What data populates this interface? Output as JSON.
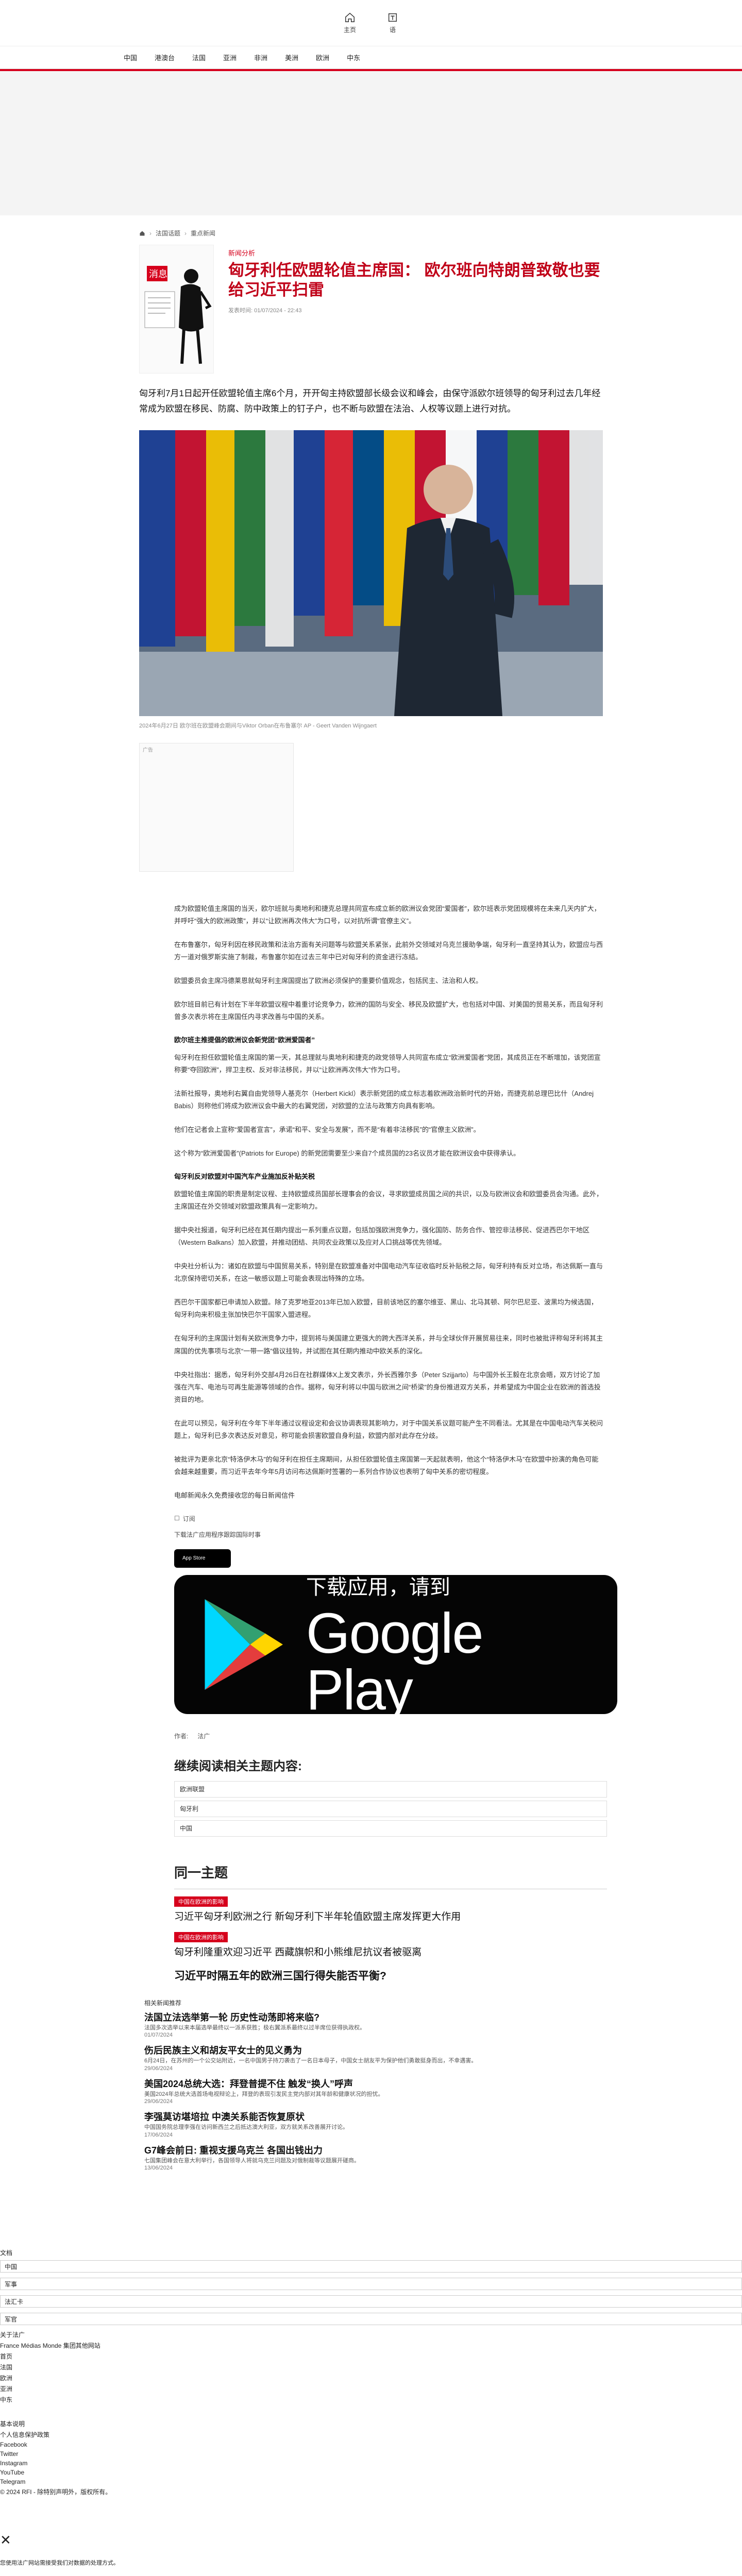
{
  "topbar": {
    "home_label": "主页",
    "lang_label": "语"
  },
  "nav": [
    "中国",
    "港澳台",
    "法国",
    "亚洲",
    "非洲",
    "美洲",
    "欧洲",
    "中东"
  ],
  "breadcrumb": [
    "首页",
    "法国话题",
    "重点新闻"
  ],
  "article": {
    "kicker": "新闻分析",
    "title": "匈牙利任欧盟轮值主席国： 欧尔班向特朗普致敬也要给习近平扫雷",
    "meta": "发表时间: 01/07/2024 - 22:43",
    "lead": "匈牙利7月1日起开任欧盟轮值主席6个月，开开匈主持欧盟部长级会议和峰会，由保守派欧尔班领导的匈牙利过去几年经常成为欧盟在移民、防腐、防中政策上的钉子户，也不断与欧盟在法治、人权等议题上进行对抗。",
    "caption": "2024年6月27日 欧尔班在欧盟峰会期间与Viktor Orban在布鲁塞尔 AP - Geert Vanden Wijngaert",
    "ad_label": "广告",
    "paragraphs": [
      "成为欧盟轮值主席国的当天，欧尔班就与奥地利和捷克总理共同宣布成立新的欧洲议会党团“爱国者”，欧尔班表示党团规模将在未来几天内扩大，并呼吁“强大的欧洲政策”，并以“让欧洲再次伟大”为口号，以对抗所谓“官僚主义”。",
      "在布鲁塞尔，匈牙利因在移民政策和法治方面有关问题等与欧盟关系紧张，此前外交领域对乌克兰援助争端，匈牙利一直坚持其认为，欧盟应与西方一道对俄罗斯实施了制裁，布鲁塞尔如在过去三年中已对匈牙利的资金进行冻结。",
      "欧盟委员会主席冯德莱恩就匈牙利主席国提出了欧洲必须保护的重要价值观念，包括民主、法治和人权。",
      "欧尔班目前已有计划在下半年欧盟议程中着重讨论竞争力，欧洲的国防与安全、移民及欧盟扩大，也包括对中国、对美国的贸易关系，而且匈牙利曾多次表示将在主席国任内寻求改善与中国的关系。"
    ],
    "h1": "欧尔班主推提倡的欧洲议会新党团“欧洲爱国者”",
    "p2": [
      "匈牙利在担任欧盟轮值主席国的第一天，其总理就与奥地利和捷克的政党领导人共同宣布成立“欧洲爱国者”党团，其成员正在不断增加，该党团宣称要“夺回欧洲”，捍卫主权、反对非法移民，并以“让欧洲再次伟大”作为口号。",
      "法新社报导，奥地利右翼自由党领导人基克尔（Herbert Kickl）表示新党团的成立标志着欧洲政治新时代的开始，而捷克前总理巴比什（Andrej Babis）则称他们将成为欧洲议会中最大的右翼党团，对欧盟的立法与政策方向具有影响。",
      "他们在记者会上宣称“爱国者宣言”，承诺“和平、安全与发展”，而不是“有着非法移民”的“官僚主义欧洲”。",
      "这个称为“欧洲爱国者”(Patriots for Europe) 的新党团需要至少来自7个成员国的23名议员才能在欧洲议会中获得承认。"
    ],
    "h2": "匈牙利反对欧盟对中国汽车产业施加反补贴关税",
    "p3": [
      "欧盟轮值主席国的职责是制定议程、主持欧盟成员国部长理事会的会议，寻求欧盟成员国之间的共识，以及与欧洲议会和欧盟委员会沟通。此外，主席国还在外交领域对欧盟政策具有一定影响力。",
      "据中央社报道，匈牙利已经在其任期内提出一系列重点议题，包括加强欧洲竞争力，强化国防、防务合作、管控非法移民、促进西巴尔干地区（Western Balkans）加入欧盟，并推动团结、共同农业政策以及应对人口挑战等优先领域。",
      "中央社分析认为：诸如在欧盟与中国贸易关系，特别是在欧盟准备对中国电动汽车征收临时反补贴税之际，匈牙利持有反对立场，布达佩斯一直与北京保持密切关系，在这一敏感议题上可能会表现出特殊的立场。",
      "西巴尔干国家都已申请加入欧盟。除了克罗地亚2013年已加入欧盟，目前该地区的塞尔维亚、黑山、北马其顿、阿尔巴尼亚、波黑均为候选国，匈牙利向来积极主张加快巴尔干国家入盟进程。",
      "在匈牙利的主席国计划有关欧洲竞争力中，提到将与美国建立更强大的跨大西洋关系，并与全球伙伴开展贸易往来，同时也被批评称匈牙利将其主席国的优先事项与北京“一带一路”倡议挂钩，并试图在其任期内推动中欧关系的深化。",
      "中央社指出：据悉，匈牙利外交部4月26日在社群媒体X上发文表示，外长西雅尔多（Peter Szijjarto）与中国外长王毅在北京会晤，双方讨论了加强在汽车、电池与可再生能源等领域的合作。据称，匈牙利将以中国与欧洲之间“桥梁”的身份推进双方关系，并希望成为中国企业在欧洲的首选投资目的地。",
      "在此可以预见，匈牙利在今年下半年通过议程设定和会议协调表现其影响力，对于中国关系议题可能产生不同看法。尤其是在中国电动汽车关税问题上，匈牙利已多次表达反对意见，称可能会损害欧盟自身利益，欧盟内部对此存在分歧。",
      "被批评为更亲北京“特洛伊木马”的匈牙利在担任主席期间，从担任欧盟轮值主席国第一天起就表明，他这个“特洛伊木马”在欧盟中扮演的角色可能会越来越重要，而习近平去年今年5月访问布达佩斯时签署的一系列合作协议也表明了匈中关系的密切程度。"
    ],
    "more": "电邮新闻永久免费接收您的每日新闻信件"
  },
  "subscribe": {
    "label": "订阅",
    "text": "下载法广应用程序跟踪国际时事",
    "appstore": "App Store",
    "gplay_small": "下载应用，请到",
    "gplay_big": "Google Play"
  },
  "author": {
    "label": "作者:",
    "name": "法广"
  },
  "related": {
    "title": "继续阅读相关主题内容:",
    "tags": [
      "欧洲联盟",
      "匈牙利",
      "中国"
    ]
  },
  "sametopic": {
    "title": "同一主题",
    "items": [
      {
        "badge": "中国在欧洲的影响",
        "title": "习近平匈牙利欧洲之行 新匈牙利下半年轮值欧盟主席发挥更大作用"
      },
      {
        "badge": "中国在欧洲的影响",
        "title": "匈牙利隆重欢迎习近平 西藏旗帜和小熊维尼抗议者被驱离"
      },
      {
        "badge": "",
        "title": "习近平时隔五年的欧洲三国行得失能否平衡?"
      }
    ]
  },
  "more_list": {
    "head": "相关新闻推荐",
    "items": [
      {
        "title": "法国立法选举第一轮 历史性动荡即将来临?",
        "sub": "法国多次选举以来本届选举最终以一派系获胜；极右翼派系最终以过半席位获得执政权。",
        "date": "01/07/2024"
      },
      {
        "title": "伤后民族主义和胡友平女士的见义勇为",
        "sub": "6月24日，在苏州的一个公交站附近，一名中国男子持刀袭击了一名日本母子，中国女士胡友平为保护他们勇敢挺身而出，不幸遇害。",
        "date": "29/06/2024"
      },
      {
        "title": "美国2024总统大选：拜登普提不住 触发“换人”呼声",
        "sub": "美国2024年总统大选首场电视辩论上，拜登的表现引发民主党内部对其年龄和健康状况的担忧。",
        "date": "29/06/2024"
      },
      {
        "title": "李强莫访堪培拉 中澳关系能否恢复原状",
        "sub": "中国国务院总理李强在访问新西兰之后抵达澳大利亚，双方就关系改善展开讨论。",
        "date": "17/06/2024"
      },
      {
        "title": "G7峰会前日: 重视支援乌克兰 各国出钱出力",
        "sub": "七国集团峰会在意大利举行，各国领导人将就乌克兰问题及对俄制裁等议题展开磋商。",
        "date": "13/06/2024"
      }
    ]
  },
  "footer": {
    "head": "文档",
    "options": [
      "中国",
      "军事",
      "法汇卡",
      "军官"
    ],
    "lines": [
      "关于法广",
      "France Médias Monde 集团其他网站",
      "首页",
      "法国",
      "欧洲",
      "亚洲",
      "中东"
    ],
    "block": [
      "基本说明",
      "个人信息保护政策",
      "Facebook",
      "Twitter",
      "Instagram",
      "YouTube",
      "Telegram"
    ],
    "copyright": "© 2024 RFI - 除特别声明外，版权所有。",
    "close": "✕",
    "close_text": "您使用法广网站需接受我们对数据的处理方式。"
  }
}
